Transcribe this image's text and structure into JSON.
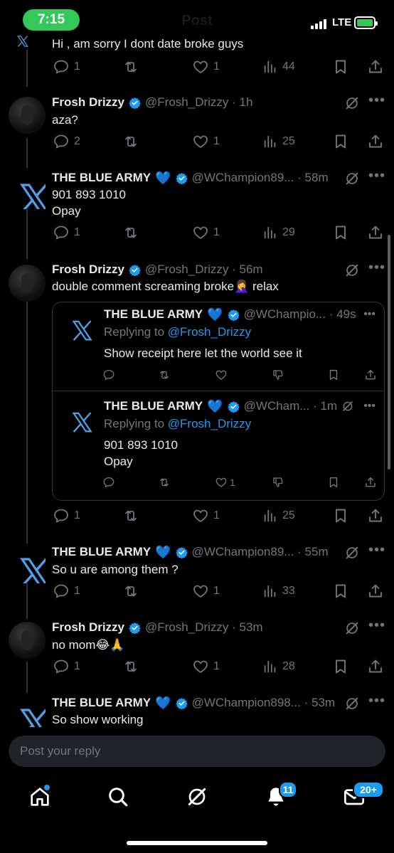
{
  "status_bar": {
    "time": "7:15",
    "network": "LTE",
    "header_title": "Post"
  },
  "partial_post": {
    "text": "Hi , am sorry I dont date broke guys"
  },
  "posts": [
    {
      "actions": {
        "replies": "1",
        "reposts": "",
        "likes": "1",
        "views": "44"
      }
    },
    {
      "name": "Frosh Drizzy",
      "handle": "@Frosh_Drizzy · 1h",
      "text": "aza?",
      "actions": {
        "replies": "2",
        "reposts": "",
        "likes": "1",
        "views": "25"
      }
    },
    {
      "name": "THE BLUE ARMY",
      "heart": "💙",
      "handle": "@WChampion89... · 58m",
      "text": "901 893 1010\nOpay",
      "actions": {
        "replies": "1",
        "reposts": "",
        "likes": "1",
        "views": "29"
      }
    },
    {
      "name": "Frosh Drizzy",
      "handle": "@Frosh_Drizzy · 56m",
      "text": "double comment screaming broke🤦‍♀️ relax",
      "actions": {
        "replies": "1",
        "reposts": "",
        "likes": "1",
        "views": "25"
      }
    },
    {
      "name": "THE BLUE ARMY",
      "heart": "💙",
      "handle": "@WChampion89... · 55m",
      "text": "So u are among them ?",
      "actions": {
        "replies": "1",
        "reposts": "",
        "likes": "1",
        "views": "33"
      }
    },
    {
      "name": "Frosh Drizzy",
      "handle": "@Frosh_Drizzy · 53m",
      "text": "no mom😂🙏",
      "actions": {
        "replies": "1",
        "reposts": "",
        "likes": "1",
        "views": "28"
      }
    },
    {
      "name": "THE BLUE ARMY",
      "heart": "💙",
      "handle": "@WChampion898... · 53m",
      "text": "So show working"
    }
  ],
  "quoted_replies": [
    {
      "name": "THE BLUE ARMY",
      "heart": "💙",
      "handle": "@WChampio... · 49s",
      "replying_prefix": "Replying to ",
      "replying_to": "@Frosh_Drizzy",
      "text": "Show receipt here let the world see it",
      "likes": ""
    },
    {
      "name": "THE BLUE ARMY",
      "heart": "💙",
      "handle": "@WCham... · 1m",
      "replying_prefix": "Replying to ",
      "replying_to": "@Frosh_Drizzy",
      "text": "901 893 1010\nOpay",
      "likes": "1"
    }
  ],
  "reply_bar": {
    "placeholder": "Post your reply"
  },
  "bottom_nav": {
    "notifications_badge": "11",
    "messages_badge": "20+"
  },
  "icons": {
    "reply": "reply-icon",
    "repost": "repost-icon",
    "like": "heart-icon",
    "views": "views-icon",
    "bookmark": "bookmark-icon",
    "share": "share-icon",
    "grok": "grok-icon",
    "more": "more-icon",
    "verified": "verified-badge-icon",
    "dislike": "thumbs-down-icon"
  },
  "colors": {
    "accent": "#1d9bf0",
    "time_pill": "#34c759",
    "muted": "#71767b",
    "background": "#000000"
  }
}
